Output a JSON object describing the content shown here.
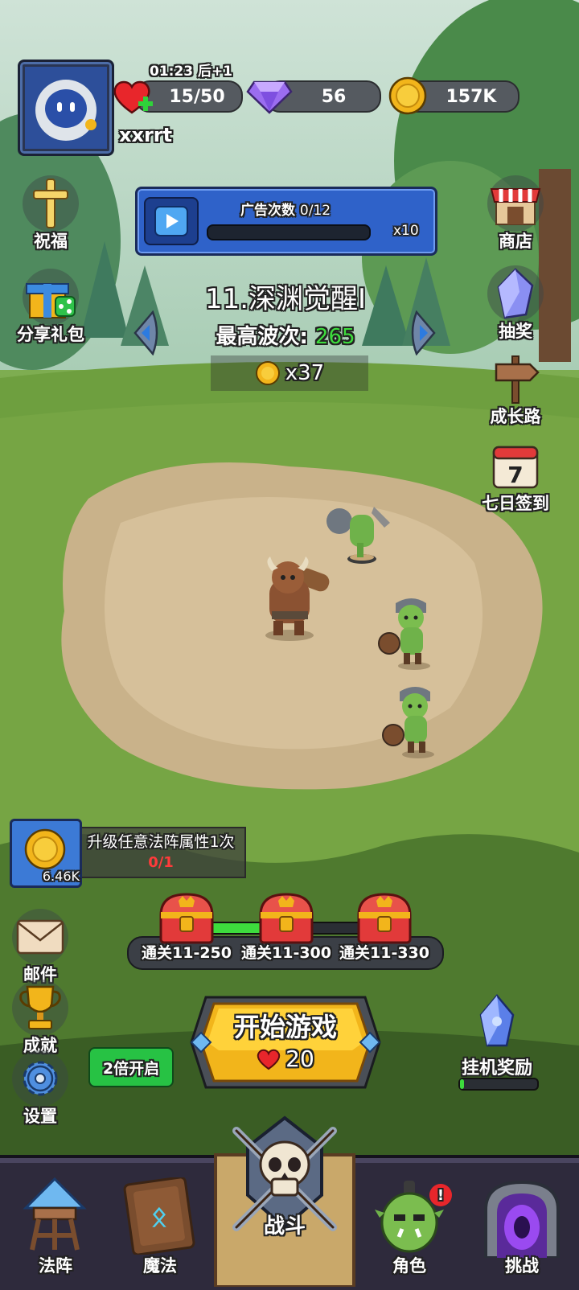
{
  "player": {
    "name": "xxrrt",
    "energy_timer": "01:23",
    "energy_regen": "后+1",
    "energy": "15/50",
    "gems": "56",
    "gold": "157K"
  },
  "side_left": {
    "bless": "祝福",
    "share": "分享礼包"
  },
  "side_right": {
    "shop": "商店",
    "lottery": "抽奖",
    "growth": "成长路",
    "checkin": "七日签到",
    "checkin_day": "7"
  },
  "ad": {
    "title": "广告次数",
    "count": "0/12",
    "multiplier": "x10",
    "progress": 0
  },
  "stage": {
    "name": "11.深渊觉醒I",
    "best_wave_label": "最高波次:",
    "best_wave_value": "265",
    "reward": "x37"
  },
  "task": {
    "reward_amount": "6.46K",
    "description": "升级任意法阵属性1次",
    "progress": "0/1"
  },
  "chests": [
    {
      "label": "通关11-250"
    },
    {
      "label": "通关11-300"
    },
    {
      "label": "通关11-330"
    }
  ],
  "left_menu": {
    "mail": "邮件",
    "achievement": "成就",
    "settings": "设置"
  },
  "speed_button": "2倍开启",
  "start": {
    "label": "开始游戏",
    "cost": "20"
  },
  "idle_reward": {
    "label": "挂机奖励",
    "progress": 0.05
  },
  "tabs": {
    "formation": "法阵",
    "magic": "魔法",
    "magic_rune": "ᛟ",
    "battle": "战斗",
    "character": "角色",
    "challenge": "挑战",
    "badge": "!"
  },
  "colors": {
    "accent_green": "#3ddc3d",
    "gold": "#f2b51b",
    "blue_panel": "#2f62c9"
  }
}
